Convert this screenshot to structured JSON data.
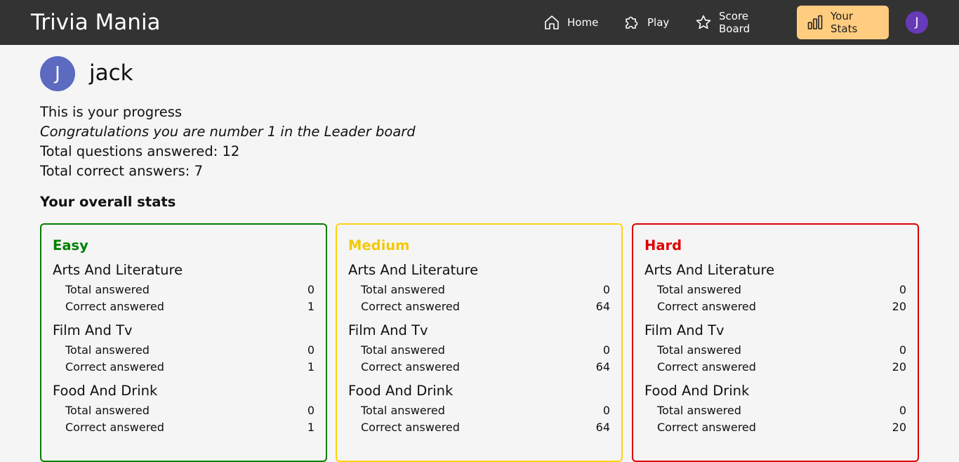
{
  "app": {
    "title": "Trivia Mania"
  },
  "nav": {
    "home": "Home",
    "play": "Play",
    "scoreboard": "Score Board",
    "stats": "Your Stats",
    "avatar_initial": "J"
  },
  "colors": {
    "topbar": "#333333",
    "active_nav": "#ffcc80",
    "easy": "#008000",
    "medium": "#ffd20f",
    "hard": "#e00000"
  },
  "user": {
    "initial": "J",
    "name": "jack"
  },
  "progress": {
    "intro": "This is your progress",
    "congrats": "Congratulations you are number 1 in the Leader board",
    "total_answered": "Total questions answered: 12",
    "total_correct": "Total correct answers: 7"
  },
  "overall_heading": "Your overall stats",
  "labels": {
    "total": "Total answered",
    "correct": "Correct answered"
  },
  "difficulties": [
    {
      "name": "Easy",
      "categories": [
        {
          "name": "Arts And Literature",
          "total": "0",
          "correct": "1"
        },
        {
          "name": "Film And Tv",
          "total": "0",
          "correct": "1"
        },
        {
          "name": "Food And Drink",
          "total": "0",
          "correct": "1"
        }
      ]
    },
    {
      "name": "Medium",
      "categories": [
        {
          "name": "Arts And Literature",
          "total": "0",
          "correct": "64"
        },
        {
          "name": "Film And Tv",
          "total": "0",
          "correct": "64"
        },
        {
          "name": "Food And Drink",
          "total": "0",
          "correct": "64"
        }
      ]
    },
    {
      "name": "Hard",
      "categories": [
        {
          "name": "Arts And Literature",
          "total": "0",
          "correct": "20"
        },
        {
          "name": "Film And Tv",
          "total": "0",
          "correct": "20"
        },
        {
          "name": "Food And Drink",
          "total": "0",
          "correct": "20"
        }
      ]
    }
  ]
}
